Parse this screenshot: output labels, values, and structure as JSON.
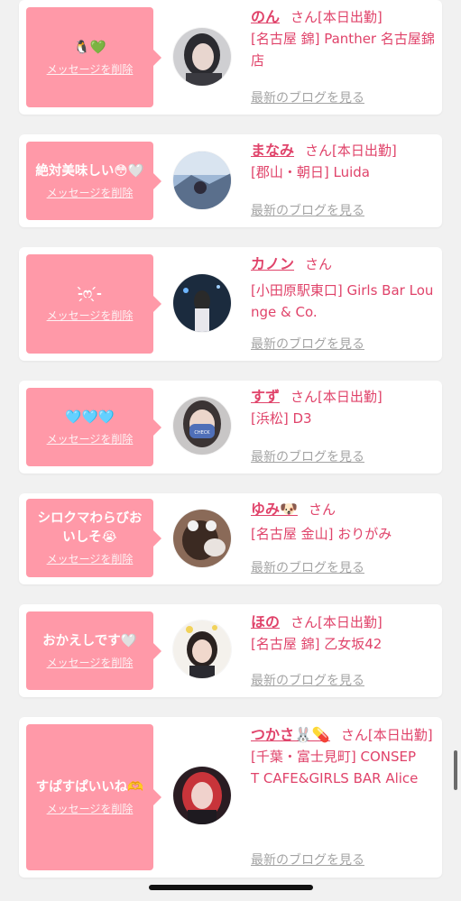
{
  "entries": [
    {
      "message": "🐧💚",
      "delete_label": "メッセージを削除",
      "name": "のん",
      "suffix": "さん[本日出勤]",
      "shop": "[名古屋 錦] Panther 名古屋錦店",
      "blog_label": "最新のブログを見る"
    },
    {
      "message": "絶対美味しい😳🤍",
      "delete_label": "メッセージを削除",
      "name": "まなみ",
      "suffix": "さん[本日出勤]",
      "shop": "[郡山・朝日] Luida",
      "blog_label": "最新のブログを見る"
    },
    {
      "message": "-̗̀ෆ ̖́-",
      "delete_label": "メッセージを削除",
      "name": "カノン",
      "suffix": "さん",
      "shop": "[小田原駅東口] Girls Bar Lounge & Co.",
      "blog_label": "最新のブログを見る"
    },
    {
      "message": "🩵🩵🩵",
      "delete_label": "メッセージを削除",
      "name": "すず",
      "suffix": "さん[本日出勤]",
      "shop": "[浜松] D3",
      "blog_label": "最新のブログを見る"
    },
    {
      "message": "シロクマわらびおいしそ😭",
      "delete_label": "メッセージを削除",
      "name": "ゆみ🐶",
      "suffix": "さん",
      "shop": "[名古屋 金山] おりがみ",
      "blog_label": "最新のブログを見る"
    },
    {
      "message": "おかえしです🤍",
      "delete_label": "メッセージを削除",
      "name": "ほの",
      "suffix": "さん[本日出勤]",
      "shop": "[名古屋 錦] 乙女坂42",
      "blog_label": "最新のブログを見る"
    },
    {
      "message": "すぱすぱいいね🫶",
      "delete_label": "メッセージを削除",
      "name": "つかさ🐰💊",
      "suffix": "さん[本日出勤]",
      "shop": "[千葉・富士見町] CONSEPT CAFE&GIRLS BAR Alice",
      "blog_label": "最新のブログを見る"
    }
  ],
  "avatar_mask_text": "CHECK",
  "colors": {
    "accent": "#e0436a",
    "bubble": "#ff99a8",
    "link_gray": "#a4a4a4",
    "background": "#f1f1f1"
  }
}
